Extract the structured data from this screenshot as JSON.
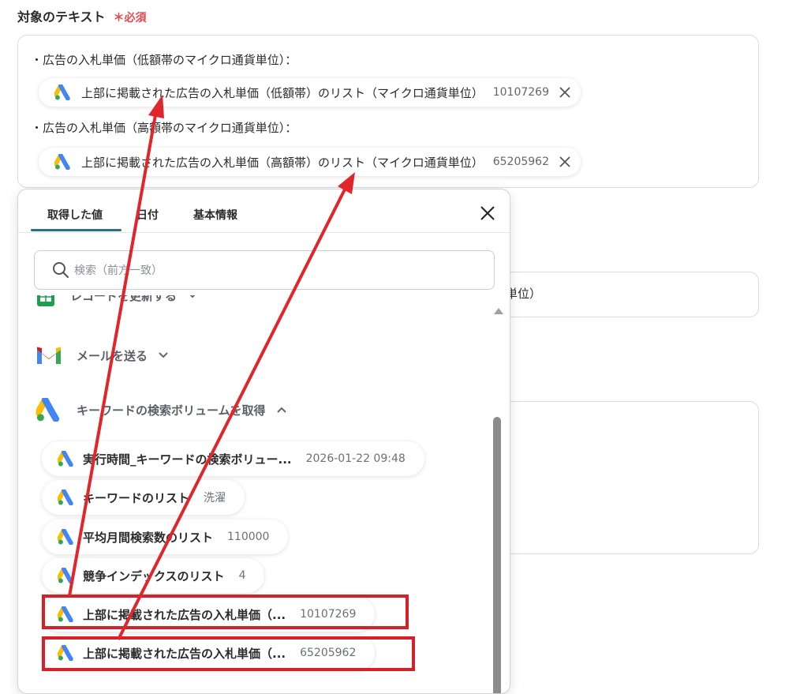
{
  "section": {
    "title": "対象のテキスト",
    "required": "＊必須"
  },
  "textbox": {
    "line1": "・広告の入札単価（低額帯のマイクロ通貨単位）：",
    "chip1": {
      "label": "上部に掲載された広告の入札単価（低額帯）のリスト（マイクロ通貨単位）",
      "value": "10107269"
    },
    "line2": "・広告の入札単価（高額帯のマイクロ通貨単位）：",
    "chip2": {
      "label": "上部に掲載された広告の入札単価（高額帯）のリスト（マイクロ通貨単位）",
      "value": "65205962"
    }
  },
  "background": {
    "partial_text": "単位）"
  },
  "panel": {
    "tabs": [
      "取得した値",
      "日付",
      "基本情報"
    ],
    "search_placeholder": "検索（前方一致）",
    "groups": [
      {
        "label": "レコードを更新する"
      },
      {
        "label": "メールを送る"
      },
      {
        "label": "キーワードの検索ボリュームを取得"
      }
    ],
    "items": [
      {
        "label": "実行時間_キーワードの検索ボリュー...",
        "value": "2026-01-22 09:48"
      },
      {
        "label": "キーワードのリスト",
        "value": "洗濯"
      },
      {
        "label": "平均月間検索数のリスト",
        "value": "110000"
      },
      {
        "label": "競争インデックスのリスト",
        "value": "4"
      },
      {
        "label": "上部に掲載された広告の入札単価（...",
        "value": "10107269"
      },
      {
        "label": "上部に掲載された広告の入札単価（...",
        "value": "65205962"
      }
    ]
  },
  "colors": {
    "accent": "#2a6f83",
    "required": "#e5484d",
    "highlight": "#d61f26",
    "arrow": "#e0262b"
  }
}
